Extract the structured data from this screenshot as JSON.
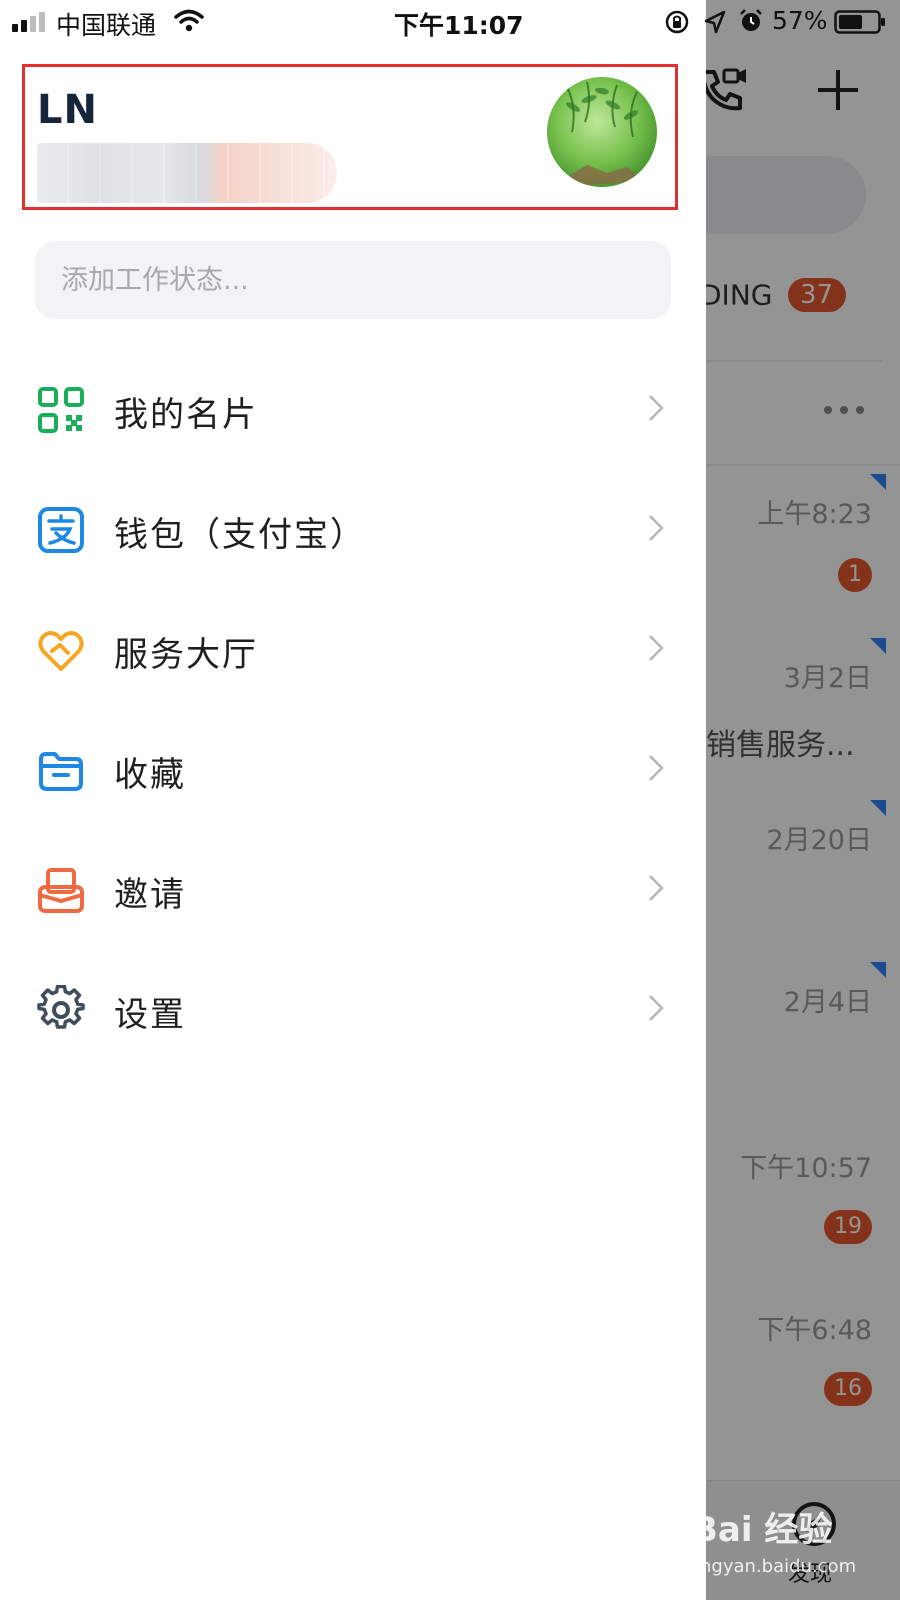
{
  "status_bar": {
    "carrier": "中国联通",
    "time": "下午11:07",
    "battery": "57%",
    "icons": [
      "signal-icon",
      "wifi-icon",
      "rotation-lock-icon",
      "location-icon",
      "alarm-icon",
      "battery-icon"
    ]
  },
  "background": {
    "tag_text": "DING",
    "tag_count": "37",
    "rows": [
      {
        "time": "上午8:23",
        "badge": "1"
      },
      {
        "time": "3月2日",
        "subtitle": "销售服务..."
      },
      {
        "time": "2月20日"
      },
      {
        "time": "2月4日"
      },
      {
        "time": "下午10:57",
        "badge": "19"
      },
      {
        "time": "下午6:48",
        "badge": "16"
      }
    ],
    "bottom_tab": "发现",
    "icons": [
      "video-call-icon",
      "plus-icon",
      "more-icon",
      "discover-icon"
    ]
  },
  "profile": {
    "name": "LN"
  },
  "status_input": {
    "placeholder": "添加工作状态..."
  },
  "menu": [
    {
      "label": "我的名片",
      "icon": "qr-code-icon",
      "color": "#1aad5a"
    },
    {
      "label": "钱包（支付宝）",
      "icon": "alipay-icon",
      "color": "#1e88e5"
    },
    {
      "label": "服务大厅",
      "icon": "heart-handshake-icon",
      "color": "#f5a623"
    },
    {
      "label": "收藏",
      "icon": "folder-icon",
      "color": "#1e88e5"
    },
    {
      "label": "邀请",
      "icon": "invite-icon",
      "color": "#ee6a42"
    },
    {
      "label": "设置",
      "icon": "gear-icon",
      "color": "#3f4d5c"
    }
  ],
  "watermark": {
    "brand": "Bai 经验",
    "url": "jingyan.baidu.com"
  },
  "colors": {
    "highlight_border": "#e22f2f",
    "badge": "#e4572e"
  }
}
